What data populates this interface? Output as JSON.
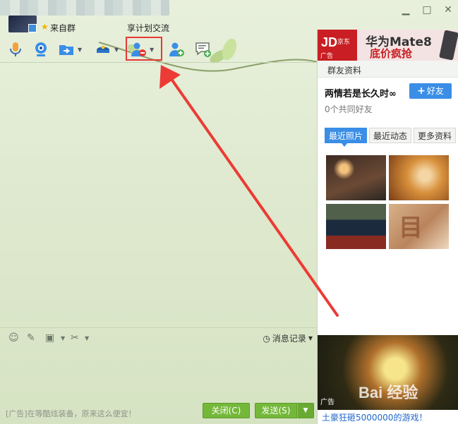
{
  "window": {
    "source_text": "来自群",
    "plan_text": "享计划交流",
    "minimize": "▁",
    "maximize": "□",
    "close": "✕"
  },
  "toolbar": {
    "items": [
      "voice-icon",
      "video-icon",
      "file-transfer-icon",
      "police-icon",
      "remove-member-icon",
      "add-member-icon",
      "message-add-icon"
    ]
  },
  "edit_toolbar": {
    "history_label": "消息记录"
  },
  "footer": {
    "ad_text": "[广告]在等酷炫装备，原来这么便宜！",
    "close_label": "关闭(C)",
    "send_label": "发送(S)"
  },
  "right_panel": {
    "ad_top": {
      "brand": "JD",
      "brand_small": "京东",
      "ad_mark": "广告",
      "title": "华为Mate8",
      "subtitle": "底价疯抢"
    },
    "header": "群友资料",
    "friend_name": "两情若是长久时∞",
    "add_friend_label": "好友",
    "common_friends": "0个共同好友",
    "tabs": [
      "最近照片",
      "最近动态",
      "更多资料"
    ],
    "ad_bottom_mark": "广告",
    "ad_bottom_logo": "Bai 经验",
    "ad_link": "土豪狂砸5000000的游戏！"
  },
  "colors": {
    "accent_blue": "#3a8ee6",
    "send_green": "#74b83a",
    "highlight_red": "#e53935"
  }
}
